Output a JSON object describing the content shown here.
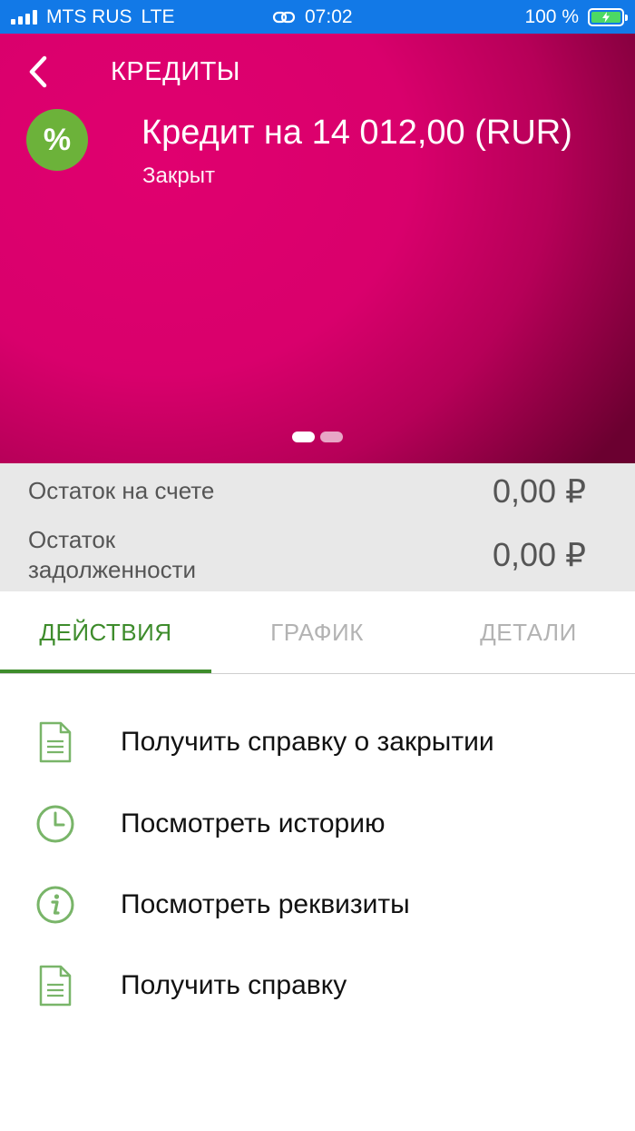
{
  "status_bar": {
    "carrier": "MTS RUS",
    "network": "LTE",
    "time": "07:02",
    "battery_percent": "100 %"
  },
  "header": {
    "back_icon": "chevron-left-icon",
    "title": "КРЕДИТЫ"
  },
  "loan": {
    "icon_symbol": "%",
    "title": "Кредит на 14 012,00 (RUR)",
    "status": "Закрыт",
    "page_indicator": {
      "current": 1,
      "total": 2
    }
  },
  "balances": [
    {
      "label": "Остаток на счете",
      "value": "0,00 ₽"
    },
    {
      "label": "Остаток задолженности",
      "value": "0,00 ₽"
    }
  ],
  "tabs": [
    {
      "label": "ДЕЙСТВИЯ",
      "active": true
    },
    {
      "label": "ГРАФИК",
      "active": false
    },
    {
      "label": "ДЕТАЛИ",
      "active": false
    }
  ],
  "actions": [
    {
      "icon": "document-icon",
      "label": "Получить справку о закрытии"
    },
    {
      "icon": "clock-icon",
      "label": "Посмотреть историю"
    },
    {
      "icon": "info-icon",
      "label": "Посмотреть реквизиты"
    },
    {
      "icon": "document-icon",
      "label": "Получить справку"
    }
  ],
  "colors": {
    "status_bar": "#1279e7",
    "hero_primary": "#e0006f",
    "accent_green": "#3e8c2c",
    "icon_green": "#6cb23a"
  }
}
